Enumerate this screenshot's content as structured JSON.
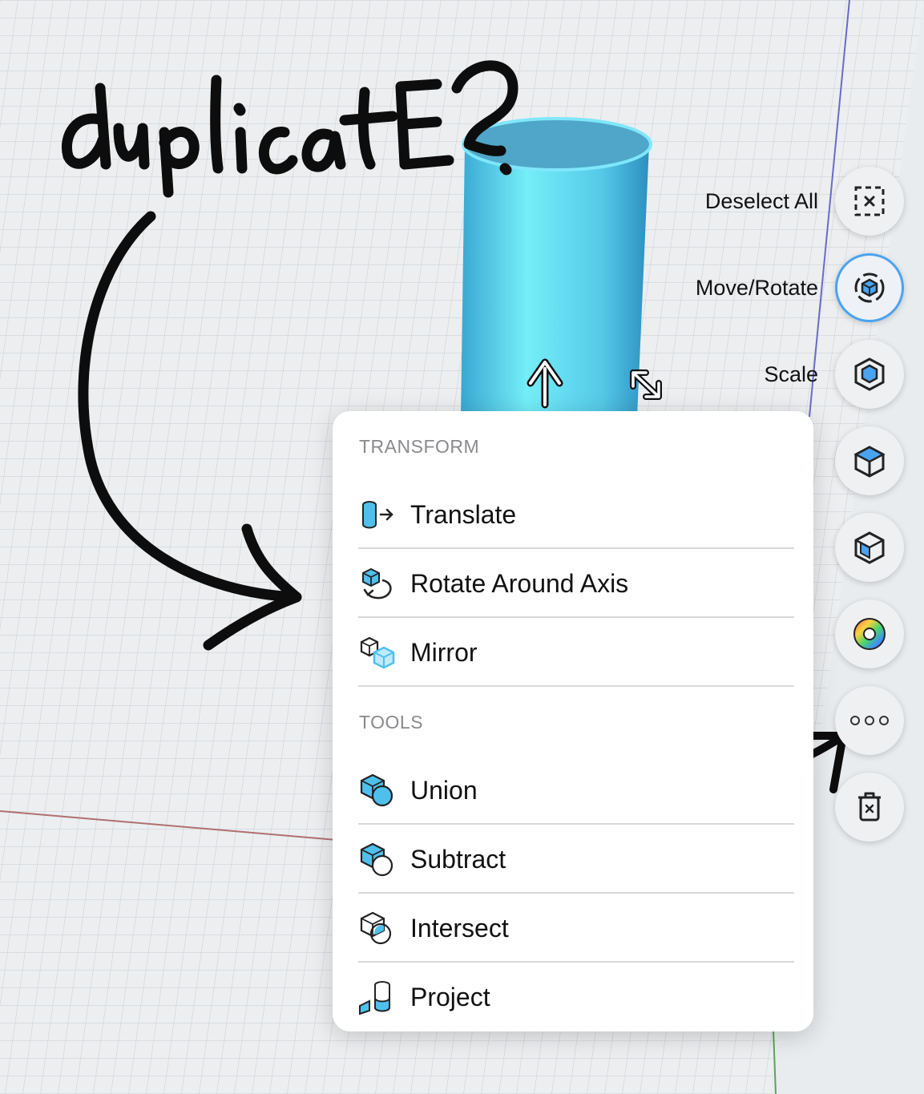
{
  "annotation": {
    "handwritten_text": "duplicatE?"
  },
  "actions": {
    "items": [
      {
        "label": "Deselect All",
        "icon": "deselect-icon"
      },
      {
        "label": "Move/Rotate",
        "icon": "move-rotate-icon",
        "active": true
      },
      {
        "label": "Scale",
        "icon": "scale-icon"
      },
      {
        "label": "Extrude",
        "icon": "extrude-icon"
      },
      {
        "label": "Shell",
        "icon": "shell-icon"
      },
      {
        "label": "Color",
        "icon": "color-wheel-icon"
      },
      {
        "label": "More",
        "icon": "more-icon"
      },
      {
        "label": "Delete",
        "icon": "trash-icon"
      }
    ],
    "visible_labels": [
      "Deselect All",
      "Move/Rotate",
      "Scale"
    ]
  },
  "menu": {
    "transform_header": "TRANSFORM",
    "transform_items": [
      {
        "label": "Translate",
        "icon": "translate-icon"
      },
      {
        "label": "Rotate Around Axis",
        "icon": "rotate-axis-icon"
      },
      {
        "label": "Mirror",
        "icon": "mirror-icon"
      }
    ],
    "tools_header": "TOOLS",
    "tools_items": [
      {
        "label": "Union",
        "icon": "union-icon"
      },
      {
        "label": "Subtract",
        "icon": "subtract-icon"
      },
      {
        "label": "Intersect",
        "icon": "intersect-icon"
      },
      {
        "label": "Project",
        "icon": "project-icon"
      }
    ]
  },
  "colors": {
    "accent": "#4aa3f0",
    "cylinder": "#5fd9ef",
    "ink": "#0d0d0d"
  }
}
